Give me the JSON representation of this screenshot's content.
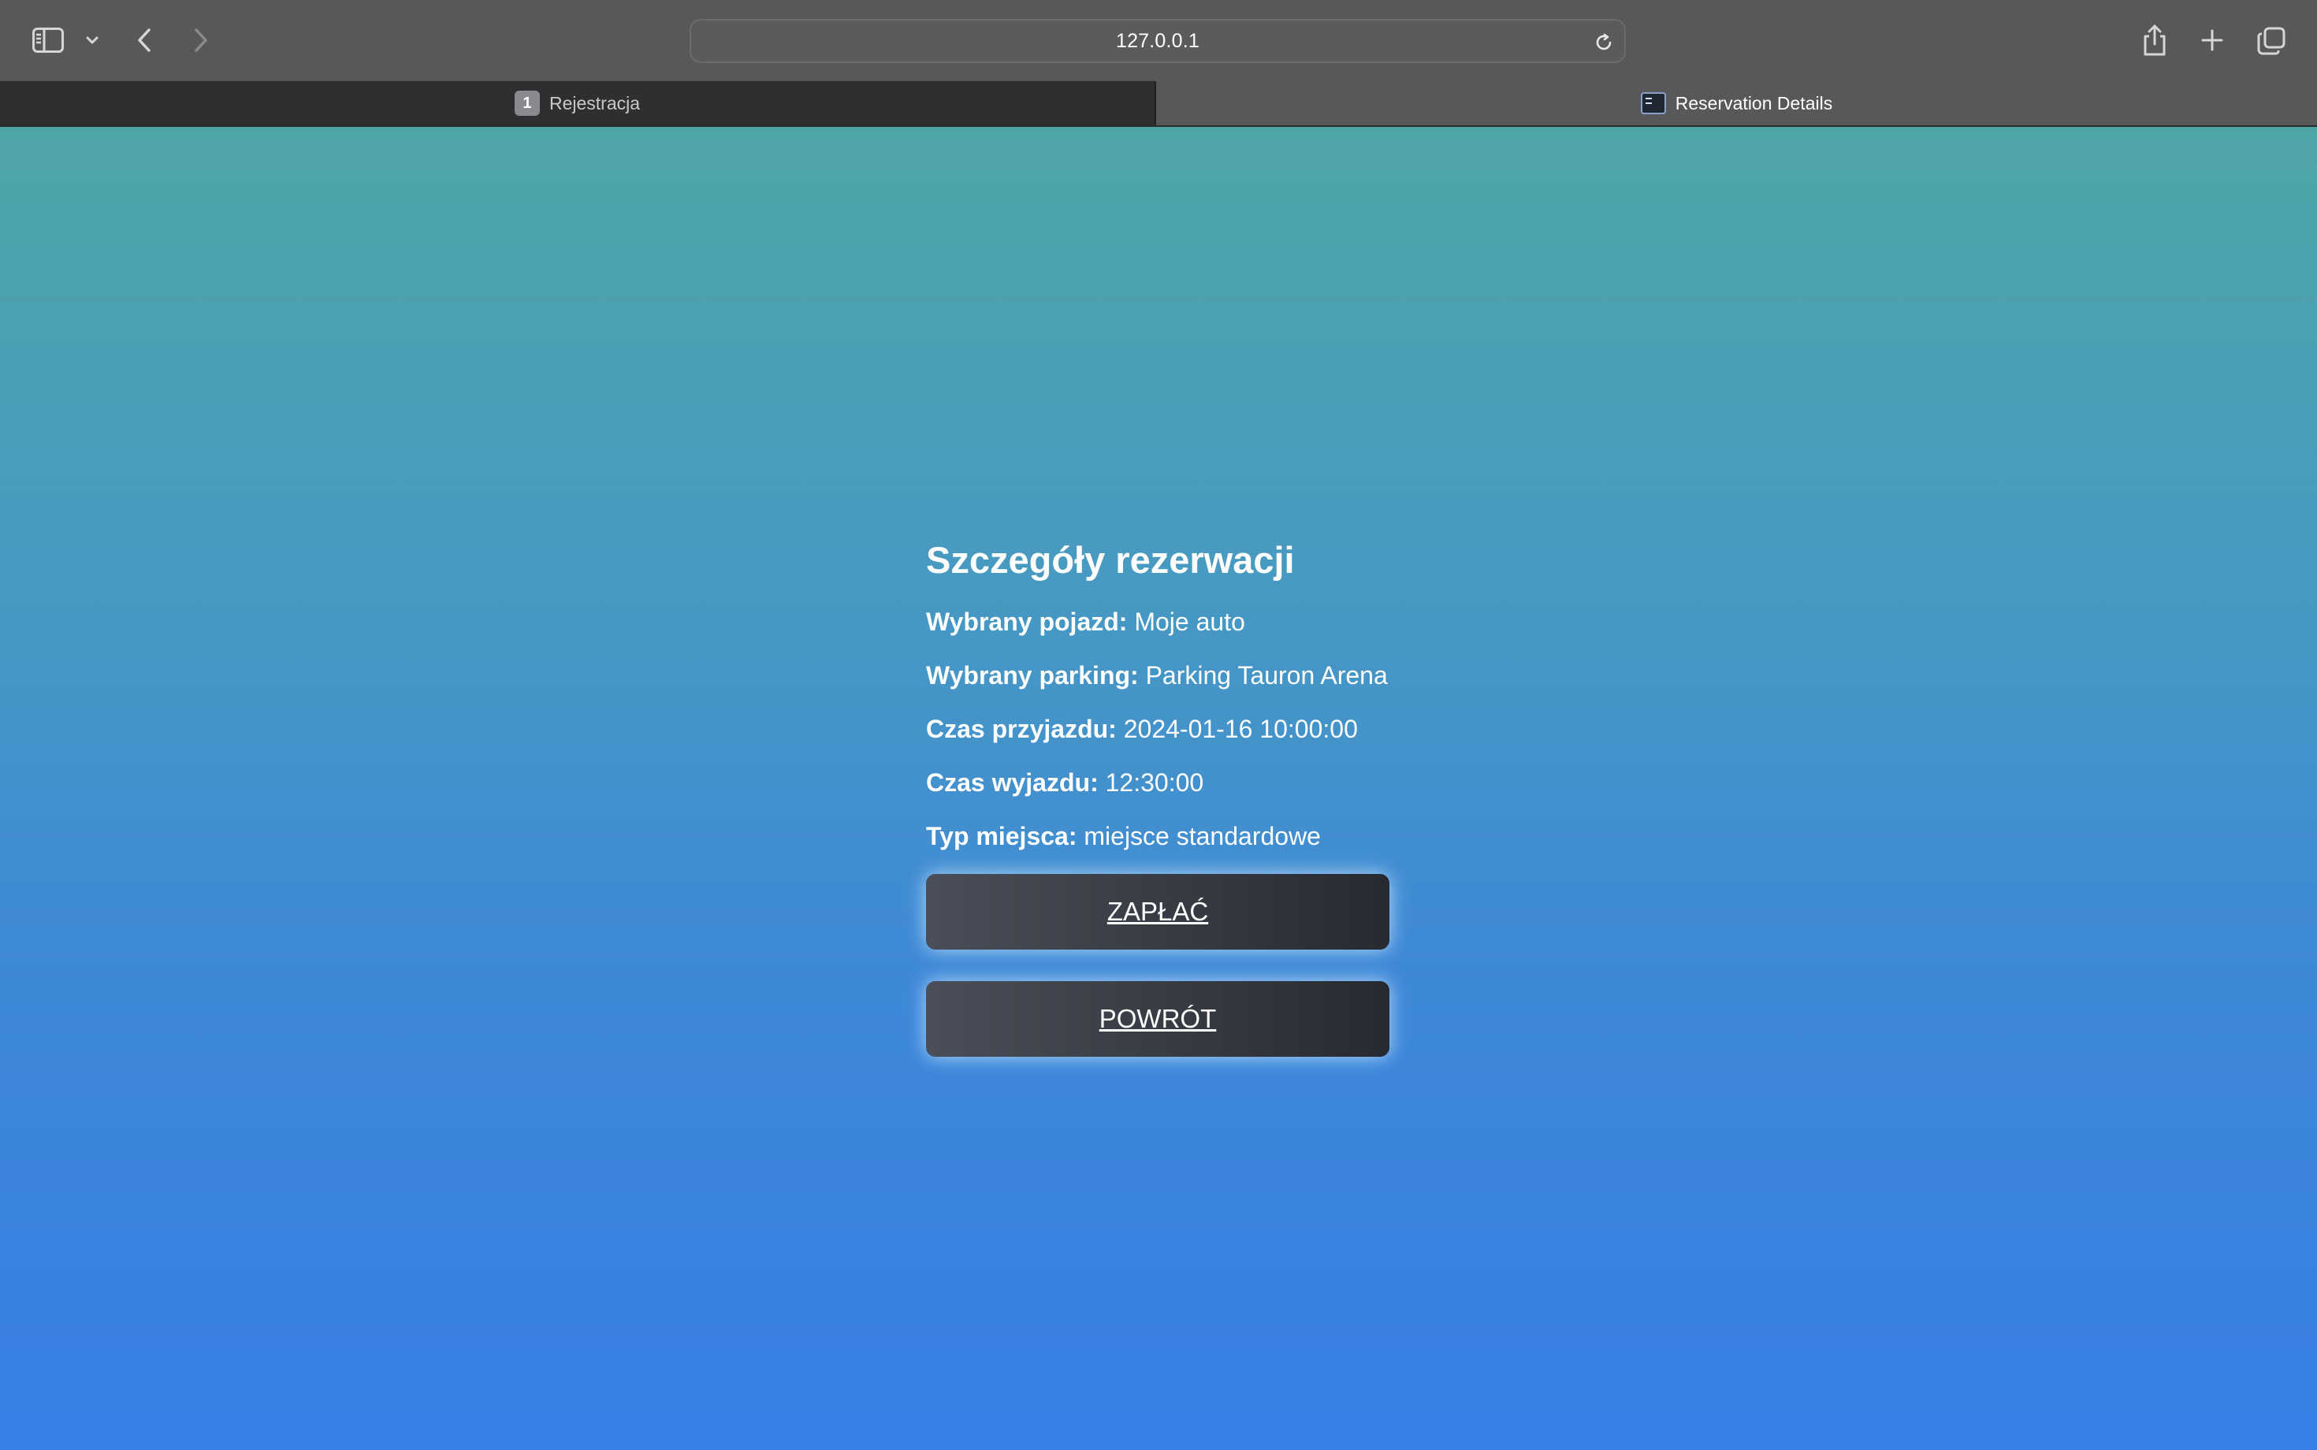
{
  "browser": {
    "address": "127.0.0.1",
    "tabs": [
      {
        "label": "Rejestracja",
        "badge": "1",
        "active": false
      },
      {
        "label": "Reservation Details",
        "active": true
      }
    ],
    "icons": [
      "sidebar-icon",
      "chevron-down-icon",
      "back-arrow-icon",
      "forward-arrow-icon",
      "reload-icon",
      "share-icon",
      "plus-icon",
      "tab-overview-icon"
    ]
  },
  "reservation": {
    "title": "Szczegóły rezerwacji",
    "fields": [
      {
        "label": "Wybrany pojazd:",
        "value": "Moje auto"
      },
      {
        "label": "Wybrany parking:",
        "value": "Parking Tauron Arena"
      },
      {
        "label": "Czas przyjazdu:",
        "value": "2024-01-16 10:00:00"
      },
      {
        "label": "Czas wyjazdu:",
        "value": "12:30:00"
      },
      {
        "label": "Typ miejsca:",
        "value": "miejsce standardowe"
      }
    ],
    "pay_button": "ZAPŁAĆ",
    "back_button": "POWRÓT"
  },
  "colors": {
    "gradient_top": "#4ea5a6",
    "gradient_bottom": "#387fe6",
    "button_start": "#4a4e58",
    "button_end": "#272a31",
    "toolbar": "#58585b"
  }
}
